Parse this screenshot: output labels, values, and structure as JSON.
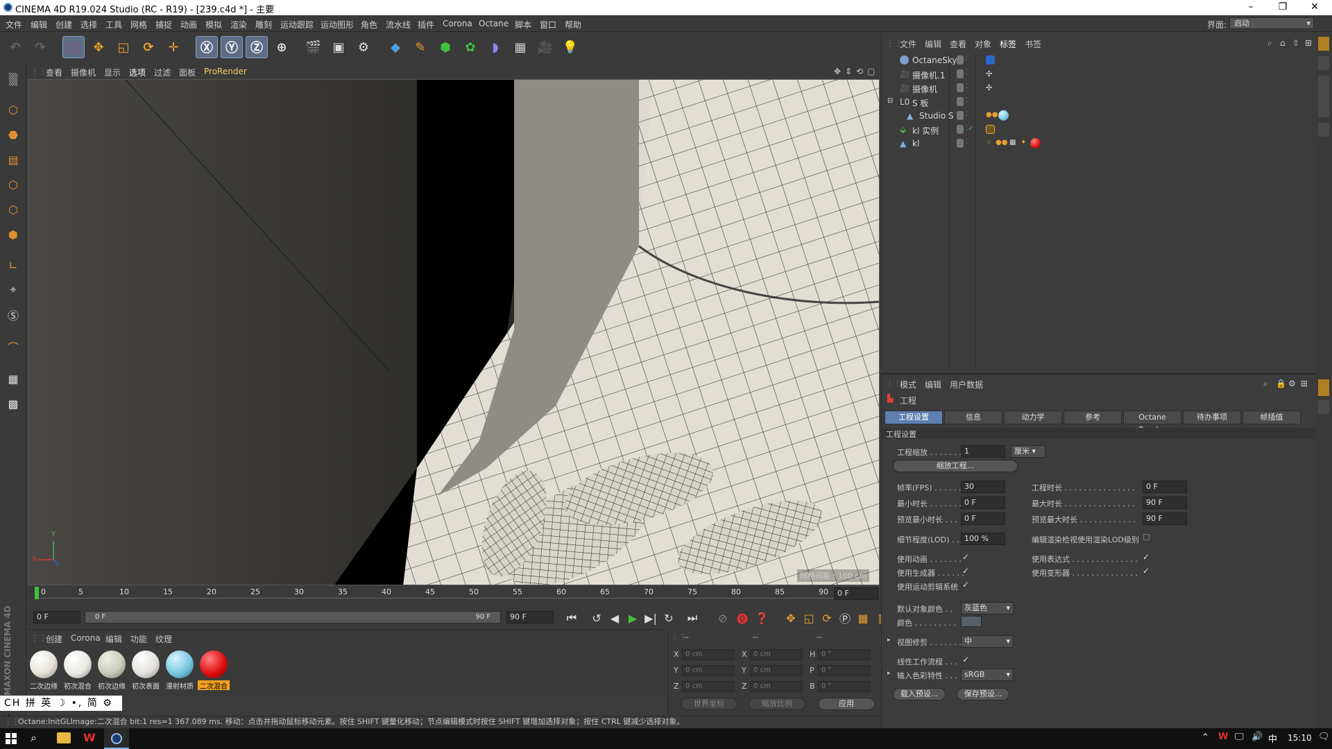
{
  "window": {
    "title": "CINEMA 4D R19.024 Studio (RC - R19) - [239.c4d *] - 主要"
  },
  "menubar": {
    "items": [
      "文件",
      "编辑",
      "创建",
      "选择",
      "工具",
      "网格",
      "捕捉",
      "动画",
      "模拟",
      "渲染",
      "雕刻",
      "运动跟踪",
      "运动图形",
      "角色",
      "流水线",
      "插件",
      "Corona",
      "Octane",
      "脚本",
      "窗口",
      "帮助"
    ],
    "interface_label": "界面:",
    "interface_value": "启动"
  },
  "viewport": {
    "menu": [
      "查看",
      "摄像机",
      "显示",
      "选项",
      "过滤",
      "面板",
      "ProRender"
    ],
    "grid_label": "网格间距 : 100 cm",
    "axis": {
      "x": "X",
      "y": "Y"
    }
  },
  "timeline": {
    "ticks": [
      "0",
      "5",
      "10",
      "15",
      "20",
      "25",
      "30",
      "35",
      "40",
      "45",
      "50",
      "55",
      "60",
      "65",
      "70",
      "75",
      "80",
      "85",
      "90"
    ],
    "current_frame": "0 F"
  },
  "time_controls": {
    "start": "0 F",
    "range_start": "0 F",
    "range_end": "90 F",
    "end": "90 F"
  },
  "materials": {
    "menu": [
      "创建",
      "Corona",
      "编辑",
      "功能",
      "纹理"
    ],
    "items": [
      {
        "label": "二次边缘",
        "color": "#e6e2d8"
      },
      {
        "label": "初次混合",
        "color": "#eceae4"
      },
      {
        "label": "初次边缘",
        "color": "#c8ccb8"
      },
      {
        "label": "初次表面",
        "color": "#e4e2dc"
      },
      {
        "label": "漫射材质",
        "color": "#79c8e0"
      },
      {
        "label": "二次混合",
        "color": "#e01010"
      }
    ]
  },
  "coords": {
    "headers": [
      "--",
      "--",
      "--"
    ],
    "rows": [
      {
        "a": "X",
        "av": "0 cm",
        "b": "X",
        "bv": "0 cm",
        "c": "H",
        "cv": "0 °"
      },
      {
        "a": "Y",
        "av": "0 cm",
        "b": "Y",
        "bv": "0 cm",
        "c": "P",
        "cv": "0 °"
      },
      {
        "a": "Z",
        "av": "0 cm",
        "b": "Z",
        "bv": "0 cm",
        "c": "B",
        "cv": "0 °"
      }
    ],
    "world": "世界坐标",
    "scale": "缩放比例",
    "apply": "应用"
  },
  "statusbar": {
    "text": "Octane:InitGLImage:二次混合  bit:1 res=1  367.089 ms.   移动：点击并拖动鼠标移动元素。按住 SHIFT 键量化移动；节点编辑模式时按住 SHIFT 键增加选择对象；按住 CTRL 键减少选择对象。"
  },
  "ime": {
    "text": "CH 拼 英 ☽ •, 简 ⚙ ⋮"
  },
  "maxon": {
    "text": "MAXON CINEMA 4D"
  },
  "object_manager": {
    "menu": [
      "文件",
      "编辑",
      "查看",
      "对象",
      "标签",
      "书签"
    ],
    "objects": [
      {
        "name": "OctaneSky",
        "indent": 0,
        "color": "#7aa0d0"
      },
      {
        "name": "摄像机.1",
        "indent": 0,
        "color": "#aaaaaa"
      },
      {
        "name": "摄像机",
        "indent": 0,
        "color": "#aaaaaa"
      },
      {
        "name": "S 板",
        "indent": 0,
        "color": "#aaaaaa"
      },
      {
        "name": "Studio S",
        "indent": 1,
        "color": "#7fb0e0"
      },
      {
        "name": "kl 实例",
        "indent": 0,
        "color": "#4ab04a"
      },
      {
        "name": "kl",
        "indent": 0,
        "color": "#7fb0e0"
      }
    ]
  },
  "attribute_manager": {
    "menu": [
      "模式",
      "编辑",
      "用户数据"
    ],
    "title": "工程",
    "tabs": [
      "工程设置",
      "信息",
      "动力学",
      "参考",
      "Octane Render",
      "待办事项",
      "帧插值"
    ],
    "section": "工程设置",
    "scale_label": "工程缩放 . . . . . . .",
    "scale_value": "1",
    "scale_unit": "厘米",
    "scale_button": "缩放工程...",
    "fps_label": "帧率(FPS) . . . . . . .",
    "fps_value": "30",
    "proj_time_label": "工程时长 . . . . . . . . . . . . . . .",
    "proj_time_value": "0 F",
    "min_time_label": "最小时长 . . . . . . .",
    "min_time_value": "0 F",
    "max_time_label": "最大时长 . . . . . . . . . . . . . . .",
    "max_time_value": "90 F",
    "prev_min_label": "预览最小时长 . . .",
    "prev_min_value": "0 F",
    "prev_max_label": "预览最大时长 . . . . . . . . . . . .",
    "prev_max_value": "90 F",
    "lod_label": "细节程度(LOD) . .",
    "lod_value": "100 %",
    "lod_render_label": "编辑渲染检视使用渲染LOD级别",
    "use_anim": "使用动画 . . . . . . .",
    "use_expr": "使用表达式 . . . . . . . . . . . . . .",
    "use_gen": "使用生成器 . . . . . .",
    "use_deform": "使用变形器 . . . . . . . . . . . . . .",
    "use_motion": "使用运动剪辑系统",
    "default_color_label": "默认对象颜色 . .",
    "default_color_value": "灰蓝色",
    "color_label": "颜色 . . . . . . . . .",
    "view_clip_label": "视图修剪 . . . . . . .",
    "view_clip_value": "中",
    "linear_label": "线性工作流程 . . .",
    "input_color_label": "输入色彩特性 . . .",
    "input_color_value": "sRGB",
    "load_preset": "载入预设...",
    "save_preset": "保存预设..."
  },
  "taskbar": {
    "time": "15:10"
  },
  "colors": {
    "accent": "#5d7fb0",
    "selection": "#f0a020",
    "viewport_bg": "#000000"
  }
}
